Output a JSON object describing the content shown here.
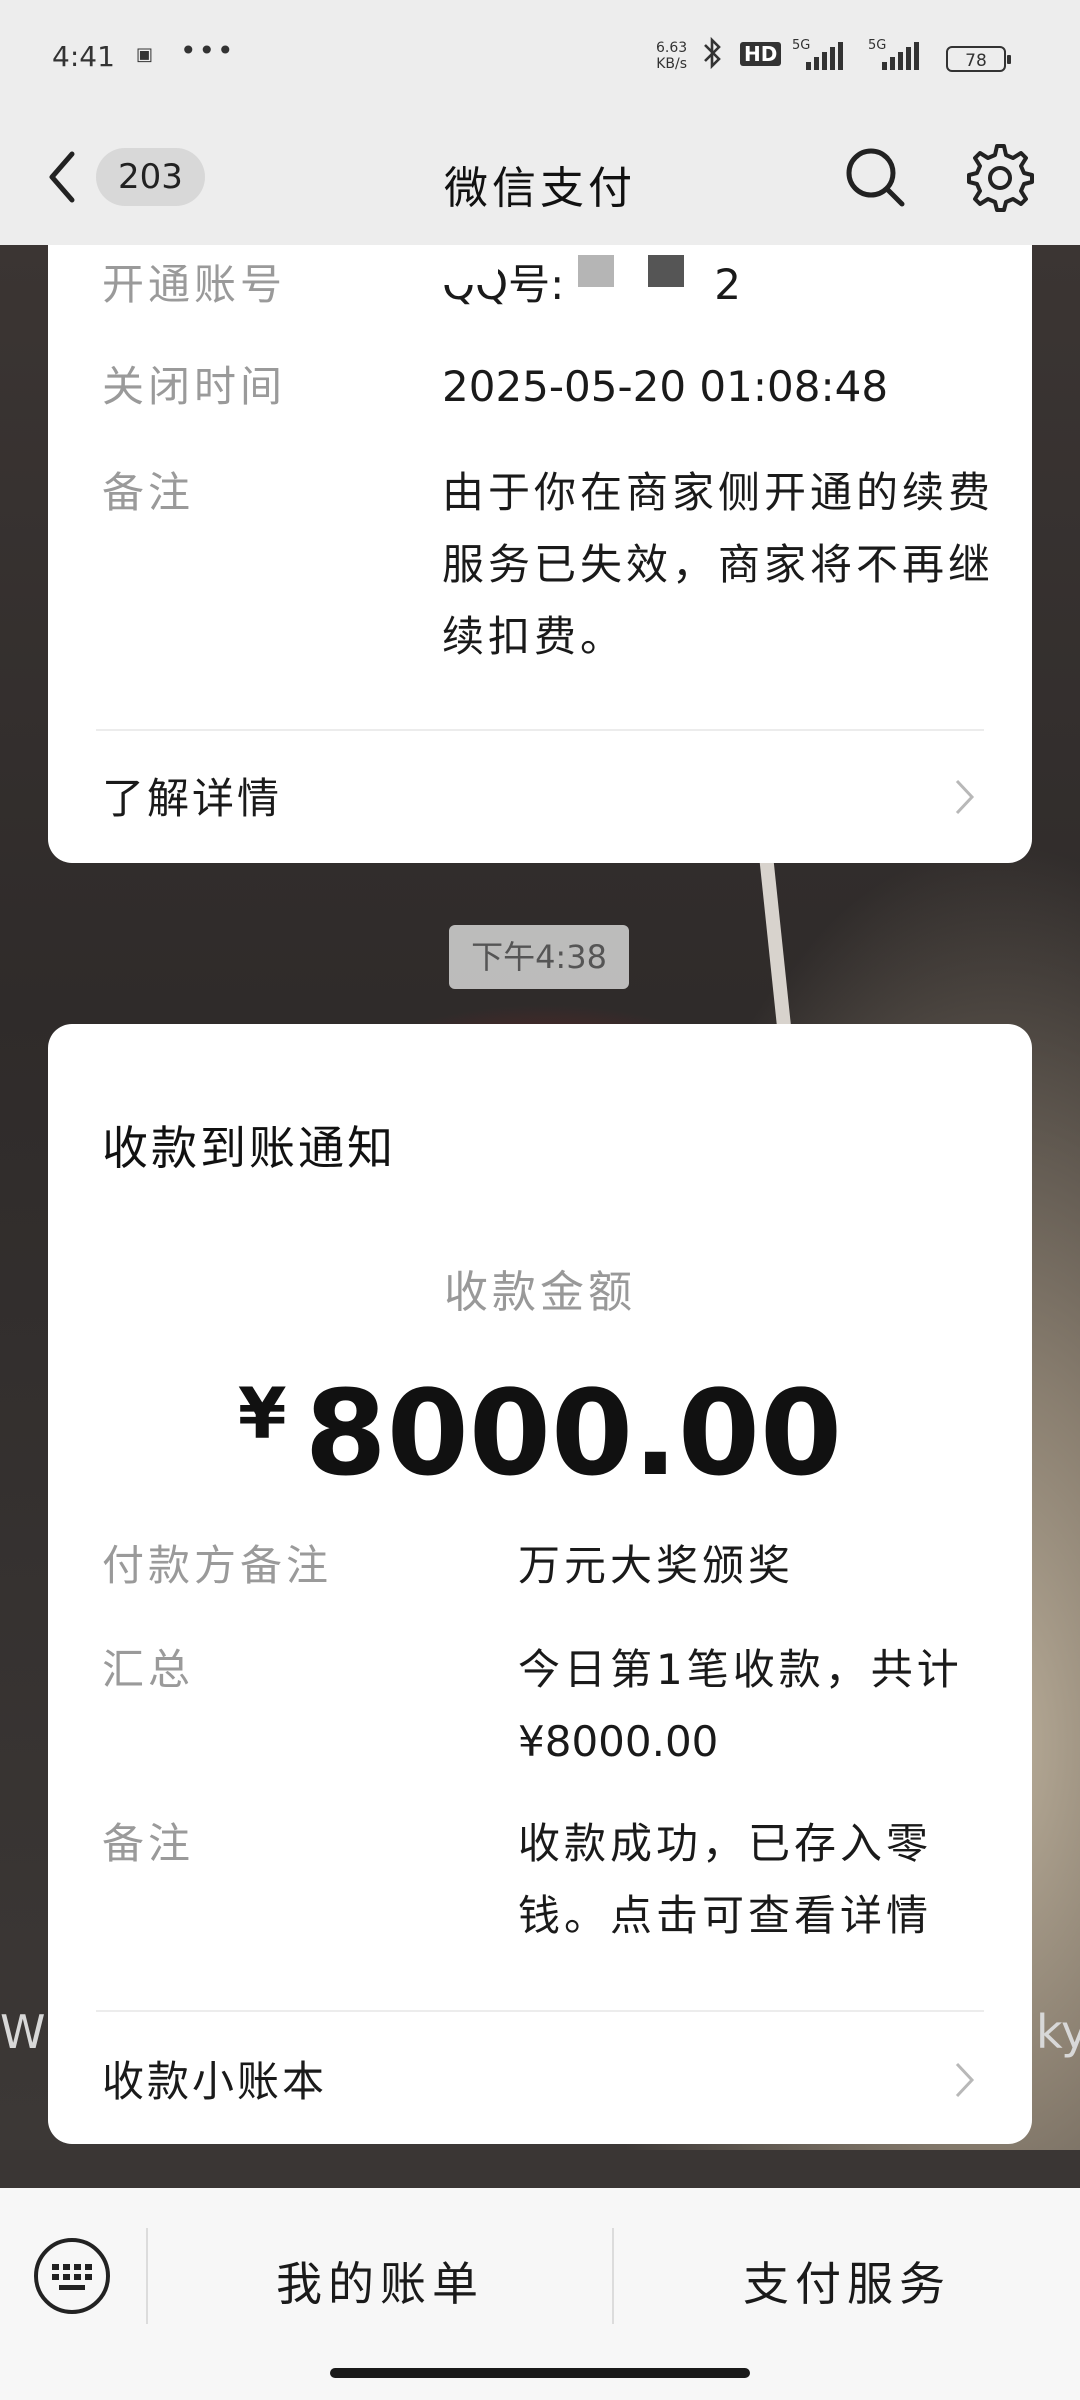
{
  "status_bar": {
    "time": "4:41",
    "notification_icon": "message-icon",
    "more": "•••",
    "net_speed_value": "6.63",
    "net_speed_unit": "KB/s",
    "bluetooth_icon": "bluetooth-icon",
    "hd_badge": "HD",
    "signal1_label": "5G",
    "signal2_label": "5G",
    "battery": "78"
  },
  "nav": {
    "back_icon": "chevron-left-icon",
    "unread_count": "203",
    "title": "微信支付",
    "search_icon": "search-icon",
    "settings_icon": "gear-icon"
  },
  "card1": {
    "rows": [
      {
        "label": "开通账号",
        "value": "QQ号:",
        "value_suffix": "2"
      },
      {
        "label": "关闭时间",
        "value": "2025-05-20 01:08:48"
      },
      {
        "label": "备注",
        "value": "由于你在商家侧开通的续费服务已失效，商家将不再继续扣费。"
      }
    ],
    "link": "了解详情"
  },
  "timestamp": "下午4:38",
  "card2": {
    "heading": "收款到账通知",
    "amount_label": "收款金额",
    "amount_currency": "¥",
    "amount_value": "8000.00",
    "rows": [
      {
        "label": "付款方备注",
        "value": "万元大奖颁奖"
      },
      {
        "label": "汇总",
        "value": "今日第1笔收款，共计",
        "value2": "¥8000.00"
      },
      {
        "label": "备注",
        "value": "收款成功，已存入零钱。点击可查看详情"
      }
    ],
    "link": "收款小账本"
  },
  "bottom_bar": {
    "keyboard_icon": "keyboard-icon",
    "menu1": "我的账单",
    "menu2": "支付服务"
  },
  "background_text": {
    "left": "W",
    "right": "ky"
  },
  "colors": {
    "bar_bg": "#ededed",
    "card_bg": "#ffffff",
    "label": "#9a9a9a",
    "text": "#1a1a1a"
  }
}
